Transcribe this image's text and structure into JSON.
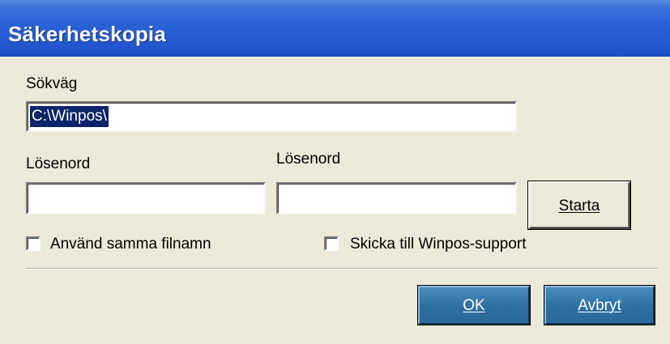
{
  "window": {
    "title": "Säkerhetskopia"
  },
  "path": {
    "label": "Sökväg",
    "value": "C:\\Winpos\\"
  },
  "password1": {
    "label": "Lösenord",
    "value": ""
  },
  "password2": {
    "label": "Lösenord",
    "value": ""
  },
  "buttons": {
    "start_label": "Starta",
    "ok_label": "OK",
    "cancel_label": "Avbryt"
  },
  "options": {
    "same_filename_label": "Använd samma filnamn",
    "same_filename_checked": false,
    "send_support_label": "Skicka till Winpos-support",
    "send_support_checked": false
  },
  "colors": {
    "titlebar": "#2b63d6",
    "dialog_bg": "#ece9d8",
    "selection": "#0b246a",
    "dialog_button": "#2f71a4"
  }
}
